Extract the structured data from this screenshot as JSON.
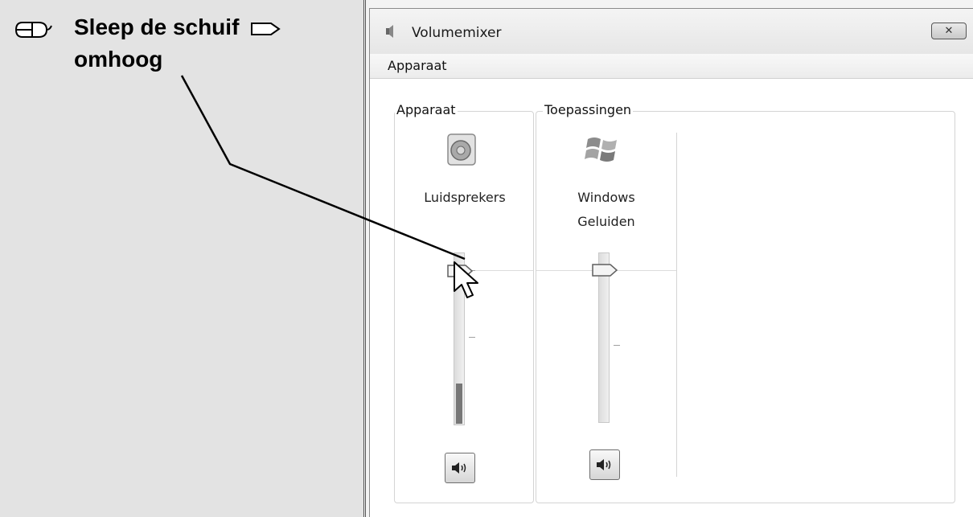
{
  "instruction": {
    "line1": "Sleep de schuif",
    "line2": "omhoog",
    "mouse_icon": "mouse-icon",
    "arrow_icon": "arrow-right-icon"
  },
  "window": {
    "title": "Volumemixer",
    "close_label": "✕",
    "menu": [
      "Apparaat"
    ]
  },
  "groups": {
    "device": {
      "title": "Apparaat",
      "channel": {
        "label": "Luidsprekers",
        "icon": "speaker-icon",
        "volume_fraction": 0.92,
        "mute_icon": "speaker-icon"
      }
    },
    "applications": {
      "title": "Toepassingen",
      "channel": {
        "label_line1": "Windows",
        "label_line2": "Geluiden",
        "icon": "windows-logo-icon",
        "volume_fraction": 0.92,
        "mute_icon": "speaker-icon"
      }
    }
  },
  "colors": {
    "panel_bg": "#e3e3e3",
    "callout_line": "#000000"
  }
}
